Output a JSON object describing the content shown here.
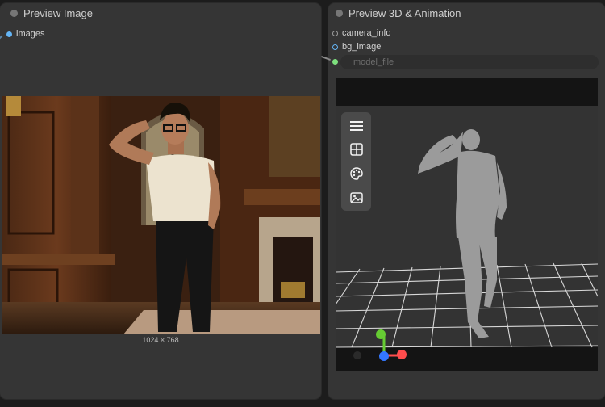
{
  "nodes": [
    {
      "title": "Preview Image",
      "inputs": [
        {
          "label": "images",
          "color": "#64b5f6"
        }
      ],
      "image_size_label": "1024 × 768"
    },
    {
      "title": "Preview 3D & Animation",
      "inputs": [
        {
          "label": "camera_info",
          "color": "#9e9e9e"
        },
        {
          "label": "bg_image",
          "color": "#64b5f6"
        }
      ],
      "model_file_widget": {
        "label": "model_file",
        "input_color": "#7ee07e"
      },
      "viewport_toolbar": [
        "menu-icon",
        "grid-icon",
        "palette-icon",
        "image-icon"
      ]
    }
  ],
  "colors": {
    "node_body": "#353535",
    "canvas": "#1c1c1c",
    "viewport_bg": "#333333",
    "axis_x": "#ff4d4d",
    "axis_y": "#66cc33",
    "axis_z": "#3377ff"
  }
}
